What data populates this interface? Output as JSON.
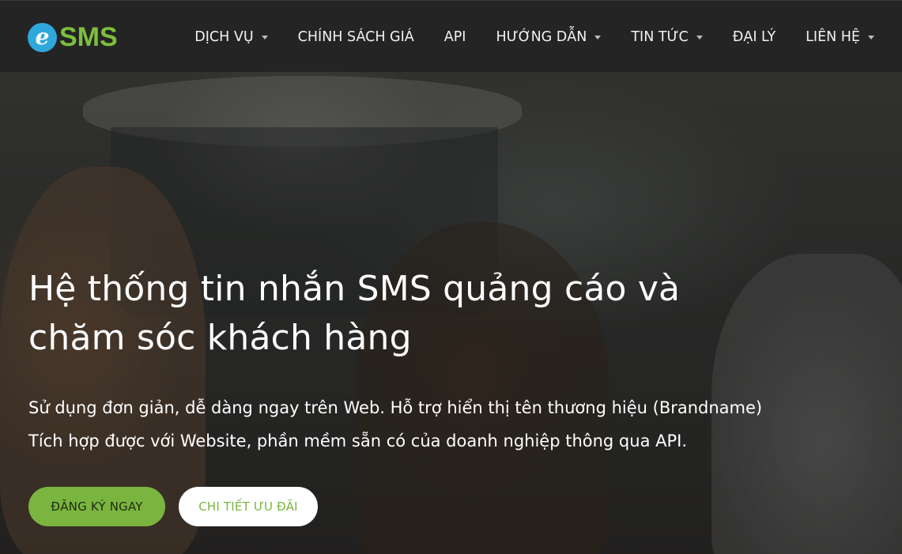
{
  "brand": {
    "logo_letter": "e",
    "logo_text": "SMS",
    "colors": {
      "blue": "#2fa8de",
      "green": "#7cbf3e"
    }
  },
  "nav": {
    "items": [
      {
        "label": "DỊCH VỤ",
        "dropdown": true
      },
      {
        "label": "CHÍNH SÁCH GIÁ",
        "dropdown": false
      },
      {
        "label": "API",
        "dropdown": false
      },
      {
        "label": "HƯỚNG DẪN",
        "dropdown": true
      },
      {
        "label": "TIN TỨC",
        "dropdown": true
      },
      {
        "label": "ĐẠI LÝ",
        "dropdown": false
      },
      {
        "label": "LIÊN HỆ",
        "dropdown": true
      }
    ]
  },
  "hero": {
    "title_line1": "Hệ thống tin nhắn SMS quảng cáo và",
    "title_line2": "chăm sóc khách hàng",
    "subtitle_line1": "Sử dụng đơn giản, dễ dàng ngay trên Web. Hỗ trợ hiển thị tên thương hiệu (Brandname)",
    "subtitle_line2": "Tích hợp được với Website, phần mềm sẵn có của doanh nghiệp thông qua API.",
    "primary_button": "ĐĂNG KÝ NGAY",
    "secondary_button": "CHI TIẾT ƯU ĐÃI"
  }
}
